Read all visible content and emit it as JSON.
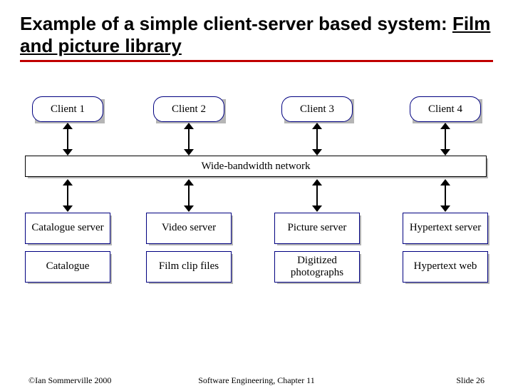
{
  "title_plain": "Example of a simple client-server based system: ",
  "title_underlined": "Film and picture library",
  "clients": [
    "Client 1",
    "Client 2",
    "Client 3",
    "Client 4"
  ],
  "network_label": "Wide-bandwidth network",
  "servers": [
    {
      "name": "Catalogue server",
      "store": "Catalogue"
    },
    {
      "name": "Video server",
      "store": "Film clip files"
    },
    {
      "name": "Picture server",
      "store": "Digitized photographs"
    },
    {
      "name": "Hypertext server",
      "store": "Hypertext web"
    }
  ],
  "footer": {
    "left": "©Ian Sommerville 2000",
    "center": "Software Engineering, Chapter 11",
    "right": "Slide 26"
  }
}
